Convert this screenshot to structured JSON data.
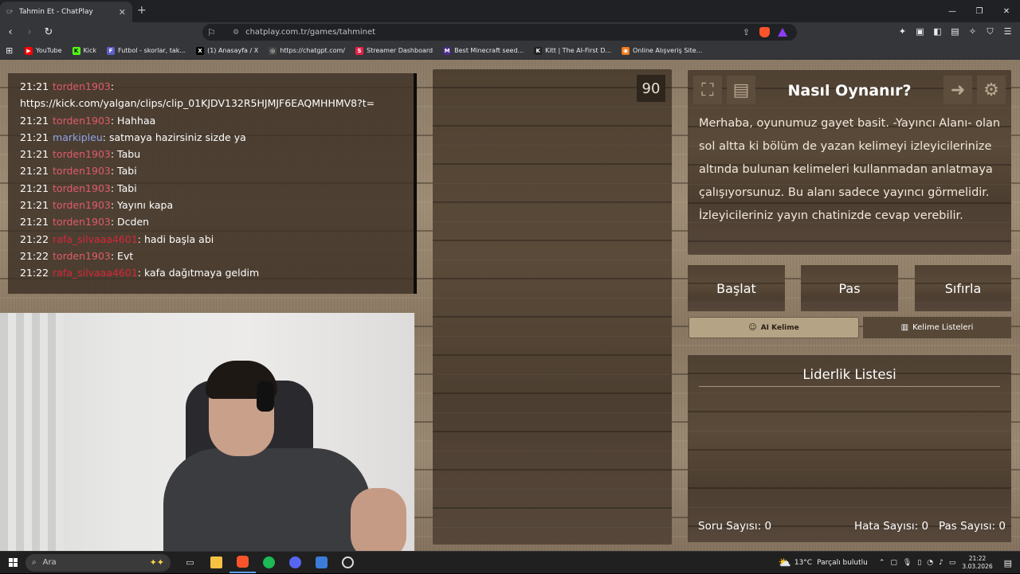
{
  "browser": {
    "tab_title": "Tahmin Et - ChatPlay",
    "tab_favicon": "CP",
    "new_tab": "+",
    "url": "chatplay.com.tr/games/tahminet",
    "bookmarks": [
      {
        "label": "YouTube",
        "icon": "youtube-icon",
        "color": "#ff0000"
      },
      {
        "label": "Kick",
        "icon": "kick-icon",
        "color": "#53fc18"
      },
      {
        "label": "Futbol - skorlar, tak...",
        "icon": "futbol-icon",
        "color": "#5b5fc7"
      },
      {
        "label": "(1) Anasayfa / X",
        "icon": "x-icon",
        "color": "#000000"
      },
      {
        "label": "https://chatgpt.com/",
        "icon": "chatgpt-icon",
        "color": "#444444"
      },
      {
        "label": "Streamer Dashboard",
        "icon": "streamer-icon",
        "color": "#e5234a"
      },
      {
        "label": "Best Minecraft seed...",
        "icon": "minecraft-icon",
        "color": "#4a2c86"
      },
      {
        "label": "Kitt | The AI-First D...",
        "icon": "kitt-icon",
        "color": "#222222"
      },
      {
        "label": "Online Alışveriş Site...",
        "icon": "shop-icon",
        "color": "#f27a1a"
      }
    ]
  },
  "chat": {
    "messages": [
      {
        "time": "21:21",
        "user": "torden1903",
        "color": "#e05a6a",
        "text": ""
      },
      {
        "time": "",
        "user": "",
        "color": "#ffffff",
        "text": "https://kick.com/yalgan/clips/clip_01KJDV132R5HJMJF6EAQMHHMV8?t="
      },
      {
        "time": "21:21",
        "user": "torden1903",
        "color": "#e05a6a",
        "text": "Hahhaa"
      },
      {
        "time": "21:21",
        "user": "markipleu",
        "color": "#8fa4e8",
        "text": "satmaya hazirsiniz sizde ya"
      },
      {
        "time": "21:21",
        "user": "torden1903",
        "color": "#e05a6a",
        "text": "Tabu"
      },
      {
        "time": "21:21",
        "user": "torden1903",
        "color": "#e05a6a",
        "text": "Tabi"
      },
      {
        "time": "21:21",
        "user": "torden1903",
        "color": "#e05a6a",
        "text": "Tabi"
      },
      {
        "time": "21:21",
        "user": "torden1903",
        "color": "#e05a6a",
        "text": "Yayını kapa"
      },
      {
        "time": "21:21",
        "user": "torden1903",
        "color": "#e05a6a",
        "text": "Dcden"
      },
      {
        "time": "21:22",
        "user": "rafa_silvaaa4601",
        "color": "#d8263a",
        "text": "hadi başla abi"
      },
      {
        "time": "21:22",
        "user": "torden1903",
        "color": "#e05a6a",
        "text": "Evt"
      },
      {
        "time": "21:22",
        "user": "rafa_silvaaa4601",
        "color": "#d8263a",
        "text": "kafa dağıtmaya geldim"
      }
    ]
  },
  "game": {
    "timer": "90",
    "help_title": "Nasıl Oynanır?",
    "help_text": "Merhaba, oyunumuz gayet basit. -Yayıncı Alanı- olan sol altta ki bölüm de yazan kelimeyi izleyicilerinize altında bulunan kelimeleri kullanmadan anlatmaya çalışıyorsunuz. Bu alanı sadece yayıncı görmelidir. İzleyicileriniz yayın chatinizde cevap verebilir.",
    "buttons": {
      "start": "Başlat",
      "pass": "Pas",
      "reset": "Sıfırla"
    },
    "ai_word": "AI Kelime",
    "word_lists": "Kelime Listeleri",
    "leaderboard_title": "Liderlik Listesi",
    "stats": {
      "questions_label": "Soru Sayısı:",
      "questions": "0",
      "errors_label": "Hata Sayısı:",
      "errors": "0",
      "passes_label": "Pas Sayısı:",
      "passes": "0"
    }
  },
  "taskbar": {
    "search_placeholder": "Ara",
    "weather": "13°C",
    "weather_desc": "Parçalı bulutlu",
    "time": "21:22",
    "date": "3.03.2026"
  }
}
